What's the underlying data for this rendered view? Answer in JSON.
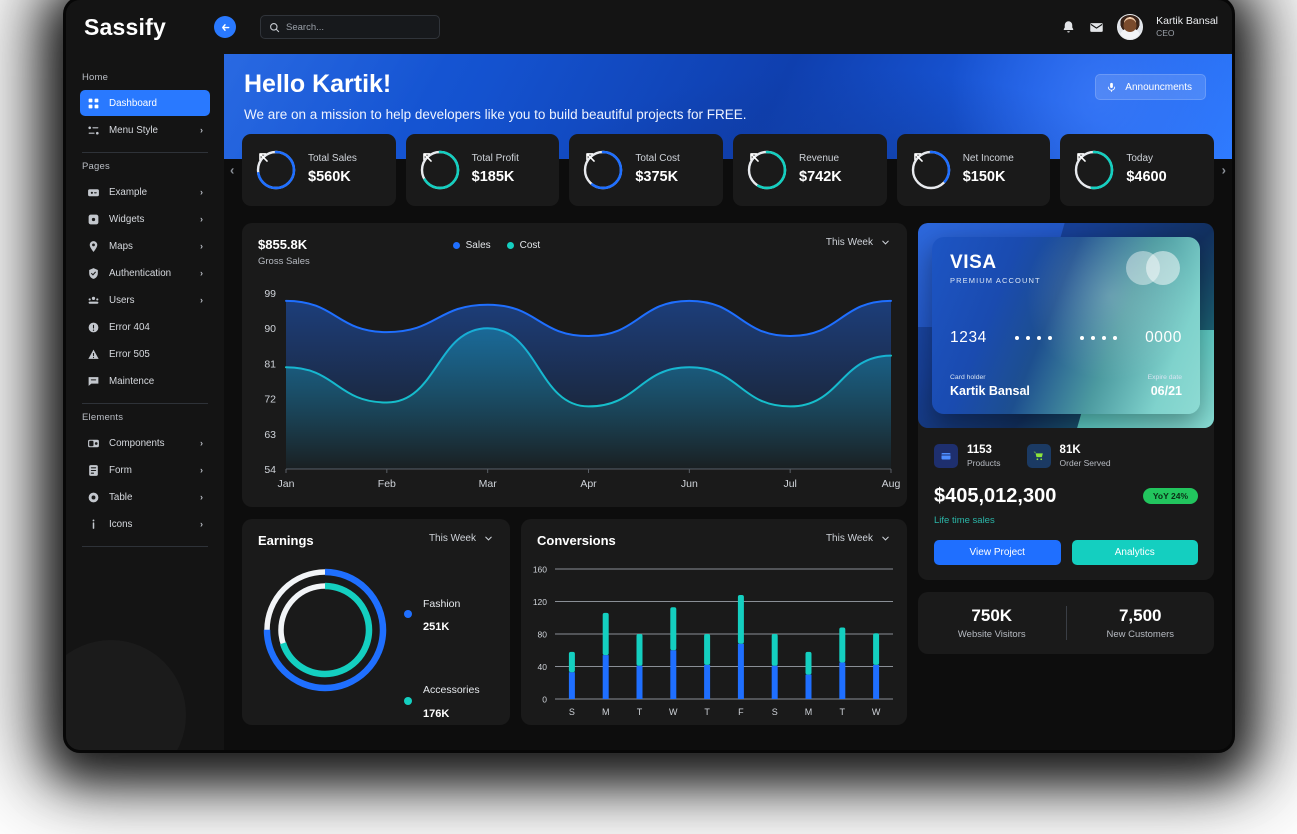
{
  "app": {
    "brand": "Sassify"
  },
  "topbar": {
    "back_icon": "arrow-left-icon",
    "search_placeholder": "Search...",
    "search_value": "",
    "bell_icon": "bell-icon",
    "mail_icon": "mail-icon",
    "user_name": "Kartik Bansal",
    "user_role": "CEO"
  },
  "sidebar": {
    "sections": [
      {
        "label": "Home",
        "items": [
          {
            "label": "Dashboard",
            "icon": "grid-icon",
            "active": true,
            "chevron": false
          },
          {
            "label": "Menu Style",
            "icon": "menu-style-icon",
            "active": false,
            "chevron": true
          }
        ]
      },
      {
        "label": "Pages",
        "items": [
          {
            "label": "Example",
            "icon": "example-icon",
            "active": false,
            "chevron": true
          },
          {
            "label": "Widgets",
            "icon": "widgets-icon",
            "active": false,
            "chevron": true
          },
          {
            "label": "Maps",
            "icon": "map-pin-icon",
            "active": false,
            "chevron": true
          },
          {
            "label": "Authentication",
            "icon": "shield-check-icon",
            "active": false,
            "chevron": true
          },
          {
            "label": "Users",
            "icon": "users-icon",
            "active": false,
            "chevron": true
          },
          {
            "label": "Error 404",
            "icon": "error-circle-icon",
            "active": false,
            "chevron": false
          },
          {
            "label": "Error 505",
            "icon": "warning-triangle-icon",
            "active": false,
            "chevron": false
          },
          {
            "label": "Maintence",
            "icon": "maintenance-icon",
            "active": false,
            "chevron": false
          }
        ]
      },
      {
        "label": "Elements",
        "items": [
          {
            "label": "Components",
            "icon": "components-icon",
            "active": false,
            "chevron": true
          },
          {
            "label": "Form",
            "icon": "form-icon",
            "active": false,
            "chevron": true
          },
          {
            "label": "Table",
            "icon": "table-icon",
            "active": false,
            "chevron": true
          },
          {
            "label": "Icons",
            "icon": "icons-icon",
            "active": false,
            "chevron": true
          }
        ]
      }
    ]
  },
  "hero": {
    "title": "Hello Kartik!",
    "subtitle": "We are on a mission to help developers like you to build beautiful projects for FREE.",
    "announcements_label": "Announcments",
    "announcements_icon": "microphone-icon"
  },
  "stats": {
    "prev_arrow": "chevron-left-icon",
    "next_arrow": "chevron-right-icon",
    "cards": [
      {
        "label": "Total Sales",
        "value": "$560K",
        "ring_color": "#1f6fff",
        "ring_pct": 72
      },
      {
        "label": "Total Profit",
        "value": "$185K",
        "ring_color": "#14cfc0",
        "ring_pct": 66
      },
      {
        "label": "Total Cost",
        "value": "$375K",
        "ring_color": "#1f6fff",
        "ring_pct": 60
      },
      {
        "label": "Revenue",
        "value": "$742K",
        "ring_color": "#14cfc0",
        "ring_pct": 58
      },
      {
        "label": "Net Income",
        "value": "$150K",
        "ring_color": "#1f6fff",
        "ring_pct": 36
      },
      {
        "label": "Today",
        "value": "$4600",
        "ring_color": "#14cfc0",
        "ring_pct": 52
      }
    ]
  },
  "gross_sales": {
    "amount": "$855.8K",
    "caption": "Gross Sales",
    "period": "This Week",
    "period_icon": "chevron-down-icon",
    "legend": [
      {
        "name": "Sales",
        "color": "#1f6fff"
      },
      {
        "name": "Cost",
        "color": "#14cfc0"
      }
    ]
  },
  "earnings": {
    "title": "Earnings",
    "period": "This Week",
    "period_icon": "chevron-down-icon",
    "items": [
      {
        "name": "Fashion",
        "value": "251K",
        "color": "#1f6fff",
        "pct": 75
      },
      {
        "name": "Accessories",
        "value": "176K",
        "color": "#14cfc0",
        "pct": 70
      }
    ]
  },
  "conversions": {
    "title": "Conversions",
    "period": "This Week",
    "period_icon": "chevron-down-icon"
  },
  "credit_card": {
    "brand": "VISA",
    "account_type": "PREMIUM ACCOUNT",
    "number_first": "1234",
    "number_last": "0000",
    "holder_label": "Card holder",
    "holder_name": "Kartik Bansal",
    "expire_label": "Expire date",
    "expire_date": "06/21"
  },
  "sales_summary": {
    "products_value": "1153",
    "products_label": "Products",
    "products_icon": "box-icon",
    "orders_value": "81K",
    "orders_label": "Order Served",
    "orders_icon": "cart-icon",
    "total": "$405,012,300",
    "badge": "YoY 24%",
    "badge_color": "#22c55e",
    "caption": "Life time sales",
    "btn_primary": "View Project",
    "btn_secondary": "Analytics"
  },
  "bottom_stats": [
    {
      "value": "750K",
      "label": "Website Visitors"
    },
    {
      "value": "7,500",
      "label": "New Customers"
    }
  ],
  "chart_data": [
    {
      "type": "area",
      "title": "Gross Sales",
      "subtitle": "$855.8K",
      "x": [
        "Jan",
        "Feb",
        "Mar",
        "Apr",
        "Jun",
        "Jul",
        "Aug"
      ],
      "xlabel": "",
      "ylabel": "",
      "ylim": [
        54,
        99
      ],
      "yticks": [
        54,
        63,
        72,
        81,
        90,
        99
      ],
      "grid": false,
      "legend_position": "top-center",
      "series": [
        {
          "name": "Sales",
          "color": "#1f6fff",
          "values": [
            97,
            89,
            96,
            88,
            97,
            88,
            97
          ]
        },
        {
          "name": "Cost",
          "color": "#14cfc0",
          "values": [
            80,
            71,
            90,
            70,
            80,
            70,
            83
          ]
        }
      ]
    },
    {
      "type": "pie",
      "title": "Earnings",
      "labels": [
        "Fashion",
        "Accessories"
      ],
      "values": [
        251,
        176
      ],
      "display_values": [
        "251K",
        "176K"
      ],
      "colors": [
        "#1f6fff",
        "#14cfc0"
      ],
      "ring_pcts": [
        75,
        70
      ],
      "legend_position": "right"
    },
    {
      "type": "bar",
      "title": "Conversions",
      "categories": [
        "S",
        "M",
        "T",
        "W",
        "T",
        "F",
        "S",
        "M",
        "T",
        "W"
      ],
      "xlabel": "",
      "ylabel": "",
      "ylim": [
        0,
        160
      ],
      "yticks": [
        0,
        40,
        80,
        120,
        160
      ],
      "grid": true,
      "stacked": true,
      "series": [
        {
          "name": "base",
          "color": "#1f6fff",
          "values": [
            33,
            54,
            41,
            60,
            42,
            68,
            41,
            30,
            45,
            42
          ]
        },
        {
          "name": "top",
          "color": "#14cfc0",
          "values": [
            25,
            52,
            39,
            53,
            38,
            60,
            39,
            28,
            43,
            39
          ]
        }
      ]
    }
  ]
}
